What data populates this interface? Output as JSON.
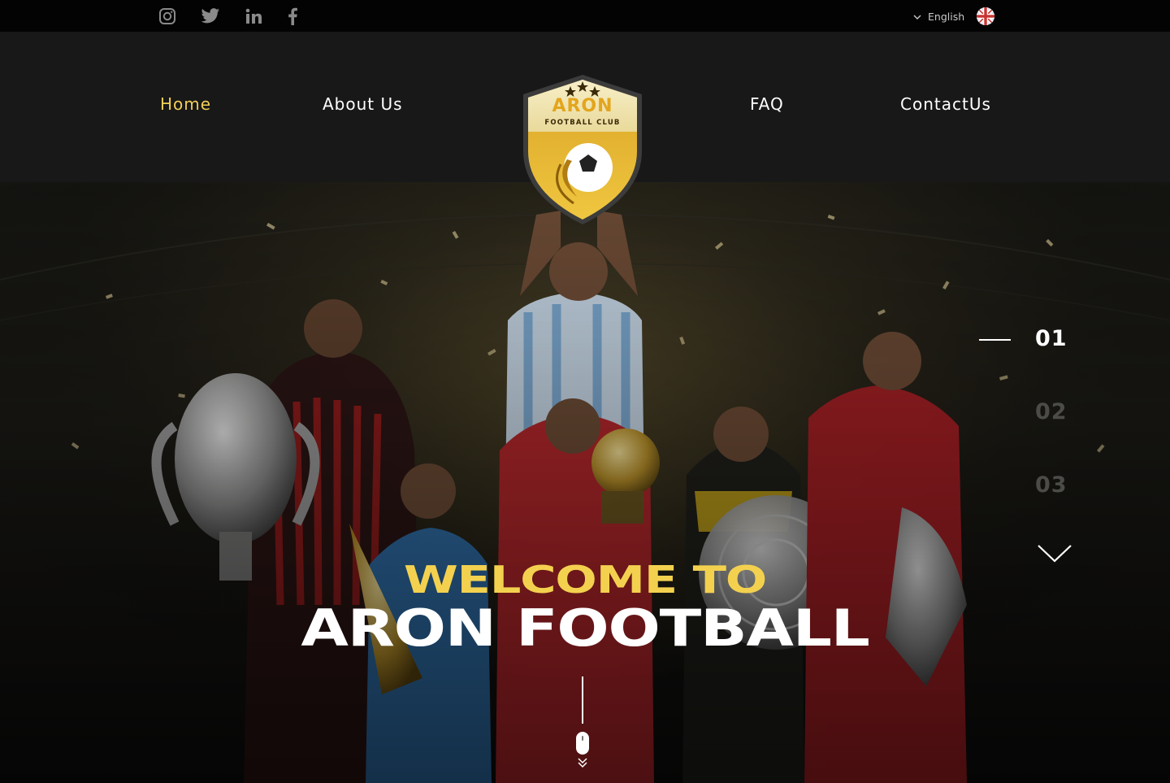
{
  "social": {
    "items": [
      {
        "name": "instagram",
        "icon": "instagram-icon"
      },
      {
        "name": "twitter",
        "icon": "twitter-icon"
      },
      {
        "name": "linkedin",
        "icon": "linkedin-icon"
      },
      {
        "name": "facebook",
        "icon": "facebook-icon"
      }
    ],
    "icon_color": "#8a8a8a"
  },
  "language": {
    "selected": "English",
    "flag_icon": "uk-flag-icon",
    "dropdown_icon": "chevron-down-icon"
  },
  "nav": {
    "items": [
      {
        "label": "Home",
        "active": true
      },
      {
        "label": "About Us",
        "active": false
      },
      {
        "label": "FAQ",
        "active": false
      },
      {
        "label": "ContactUs",
        "active": false
      }
    ],
    "active_color": "#f3cf57"
  },
  "logo": {
    "title": "ARON",
    "subtitle": "FOOTBALL CLUB",
    "icon": "football-shield-icon",
    "stars": 3
  },
  "hero": {
    "welcome": "WELCOME TO",
    "headline": "ARON FOOTBALL",
    "welcome_color": "#f3d14f",
    "slides": [
      "01",
      "02",
      "03"
    ],
    "active_slide": 0,
    "next_icon": "chevron-down-icon",
    "scroll_icon": "mouse-scroll-icon"
  }
}
